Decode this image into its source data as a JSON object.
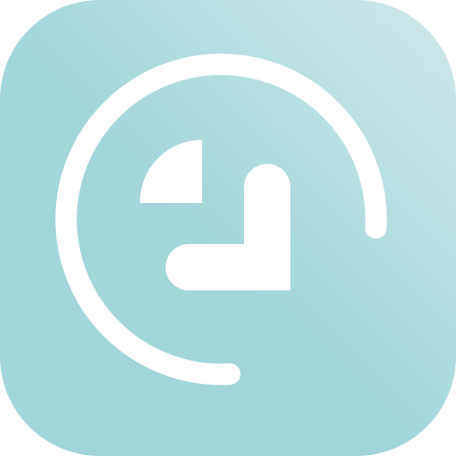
{
  "icon": {
    "name": "clock-time-tracker-app-icon",
    "colors": {
      "background_light": "#cfe9ea",
      "background_dark": "#a2d6d9",
      "glyph": "#ffffff"
    }
  }
}
